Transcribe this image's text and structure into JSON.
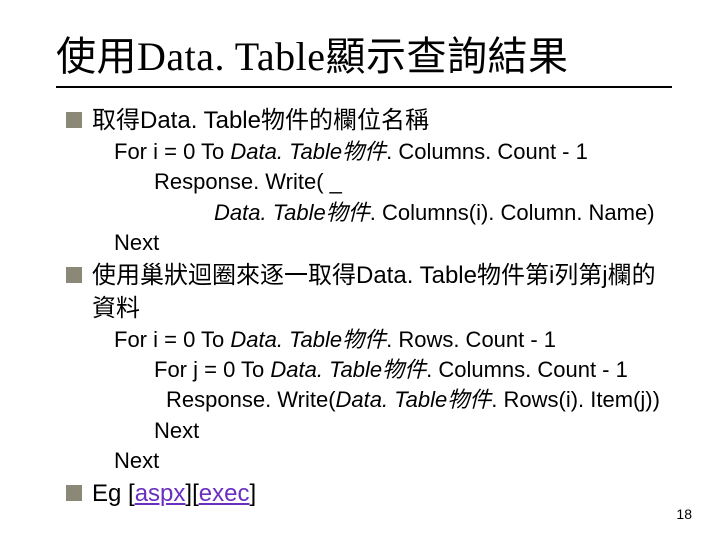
{
  "title": "使用Data. Table顯示查詢結果",
  "bullet1": "取得Data. Table物件的欄位名稱",
  "code1": {
    "l1a": "For i = 0 To ",
    "l1b": "Data. Table物件",
    "l1c": ". Columns. Count - 1",
    "l2": "Response. Write( _",
    "l3a": "Data. Table物件",
    "l3b": ". Columns(i). Column. Name)",
    "l4": "Next"
  },
  "bullet2": "使用巢狀迴圈來逐一取得Data. Table物件第i列第j欄的資料",
  "code2": {
    "l1a": "For i = 0 To ",
    "l1b": "Data. Table物件",
    "l1c": ". Rows. Count - 1",
    "l2a": "For j = 0 To ",
    "l2b": "Data. Table物件",
    "l2c": ". Columns. Count - 1",
    "l3a": "Response. Write(",
    "l3b": "Data. Table物件",
    "l3c": ". Rows(i). Item(j))",
    "l4": "Next",
    "l5": "Next"
  },
  "bullet3a": "Eg [",
  "link1": "aspx",
  "bullet3b": "][",
  "link2": "exec",
  "bullet3c": "]",
  "pagenum": "18"
}
